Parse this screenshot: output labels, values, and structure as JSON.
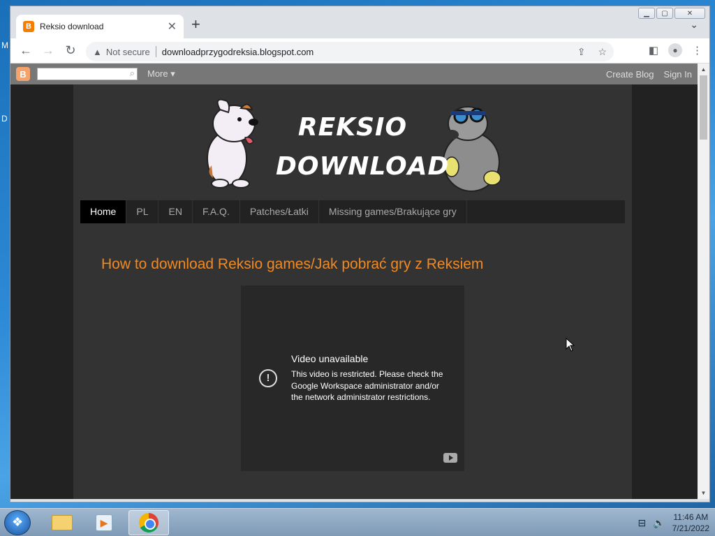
{
  "desktop": {
    "left_chars": [
      "M",
      "D"
    ]
  },
  "browser": {
    "tab_title": "Reksio download",
    "tab_favicon": "B",
    "new_tab": "+",
    "tab_close": "✕",
    "win_min": "▁",
    "win_max": "▢",
    "win_close": "✕",
    "tab_search": "⌄",
    "security_label": "Not secure",
    "url": "downloadprzygodreksia.blogspot.com"
  },
  "blogger_bar": {
    "more_label": "More ▾",
    "create_blog": "Create Blog",
    "sign_in": "Sign In"
  },
  "site": {
    "logo_line1": "REKSIO",
    "logo_line2": "DOWNLOAD",
    "nav": [
      {
        "label": "Home"
      },
      {
        "label": "PL"
      },
      {
        "label": "EN"
      },
      {
        "label": "F.A.Q."
      },
      {
        "label": "Patches/Łatki"
      },
      {
        "label": "Missing games/Brakujące gry"
      }
    ],
    "post_title": "How to download Reksio games/Jak pobrać gry z Reksiem",
    "video": {
      "title": "Video unavailable",
      "message": "This video is restricted. Please check the Google Workspace administrator and/or the network administrator restrictions."
    }
  },
  "taskbar": {
    "time": "11:46 AM",
    "date": "7/21/2022"
  }
}
